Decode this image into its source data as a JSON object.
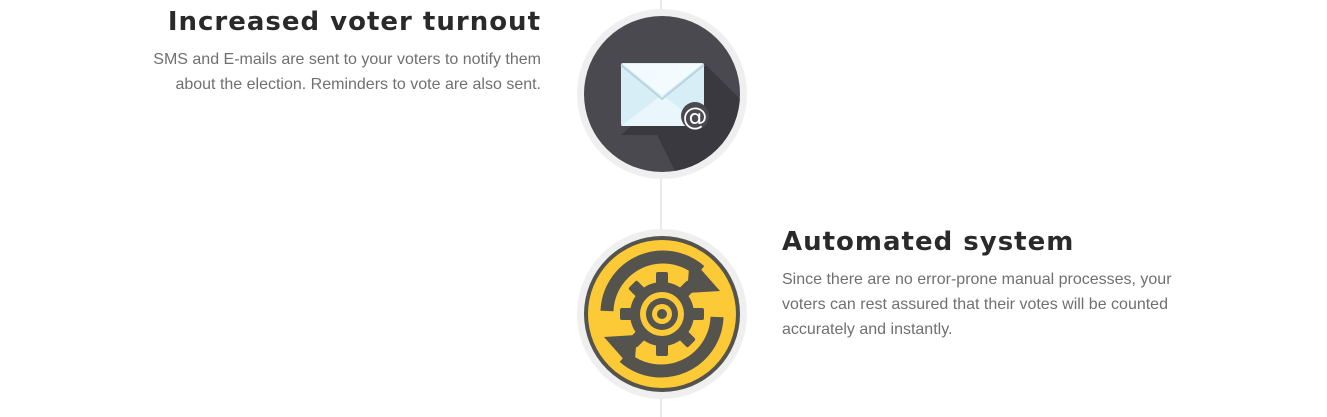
{
  "features": [
    {
      "title": "Increased voter turnout",
      "description_lines": [
        "SMS and E-mails are sent to your voters to notify them",
        "about the election. Reminders to vote are also sent."
      ],
      "icon": "email-envelope-icon",
      "icon_bg": "#4a4950"
    },
    {
      "title": "Automated system",
      "description_lines": [
        "Since there are no error-prone manual processes, your",
        "voters can rest assured that their votes will be counted",
        "accurately and instantly."
      ],
      "icon": "gear-refresh-icon",
      "icon_bg": "#fcc937"
    }
  ],
  "colors": {
    "title": "#2a2a2a",
    "description": "#707070",
    "timeline": "#e9e9e9",
    "icon_ring": "#efefef"
  }
}
